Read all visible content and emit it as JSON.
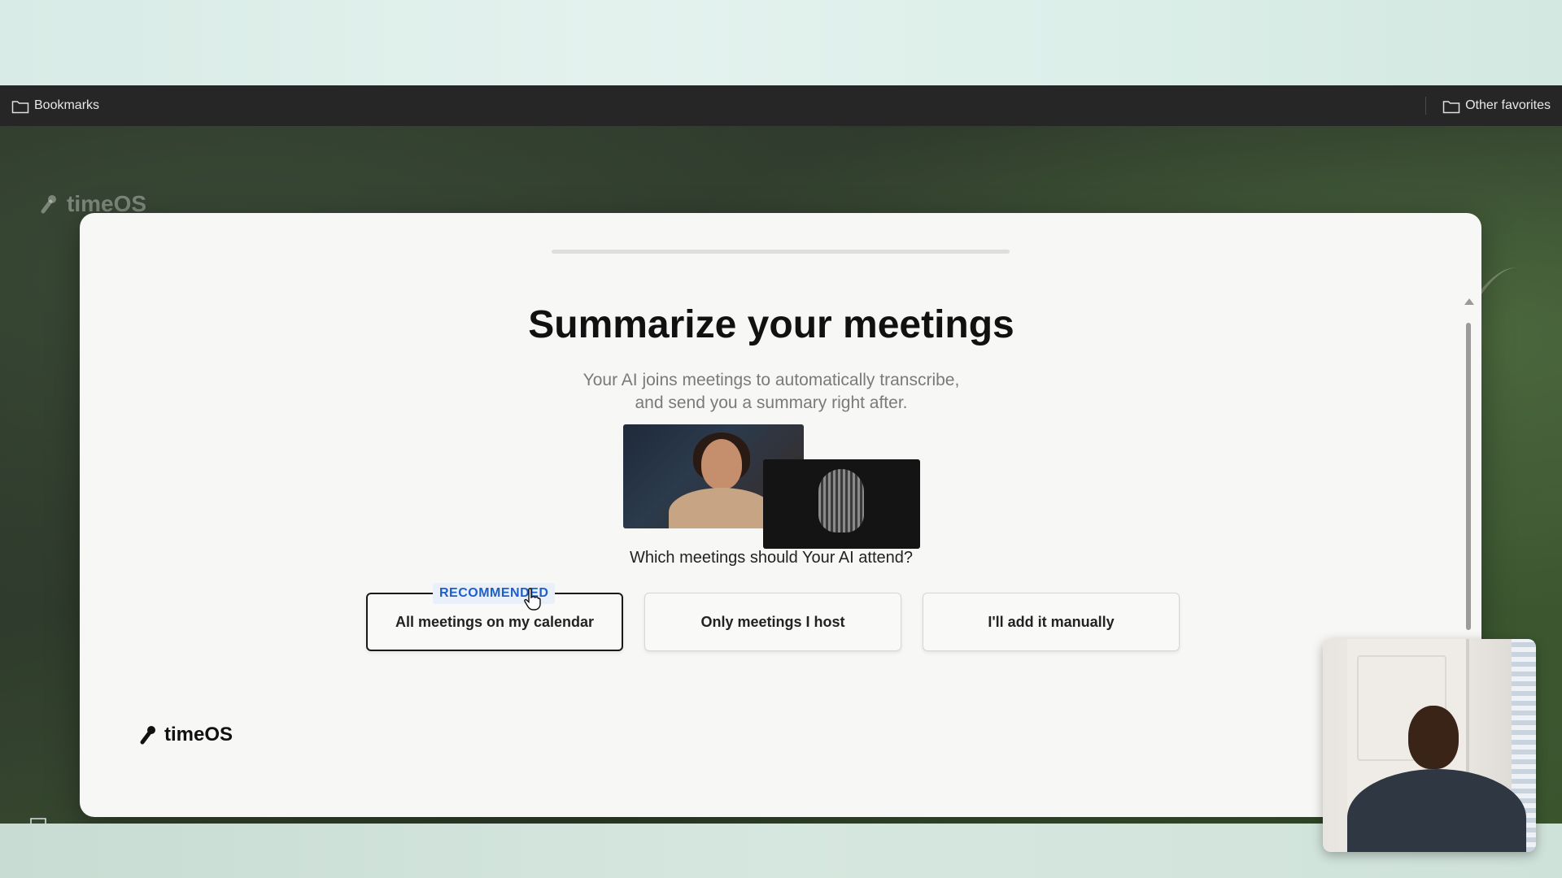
{
  "browser": {
    "bookmarks_label": "Bookmarks",
    "other_favorites_label": "Other favorites"
  },
  "background_logo": "timeOS",
  "modal": {
    "title": "Summarize your meetings",
    "subtitle_line1": "Your AI joins meetings to automatically transcribe,",
    "subtitle_line2": "and send you a summary right after.",
    "question": "Which meetings should Your AI attend?",
    "options": [
      {
        "label": "All meetings on my calendar",
        "badge": "RECOMMENDED",
        "selected": true
      },
      {
        "label": "Only meetings I host",
        "selected": false
      },
      {
        "label": "I'll add it manually",
        "selected": false
      }
    ],
    "brand": "timeOS"
  },
  "colors": {
    "accent_badge_text": "#1f5fc4",
    "accent_badge_bg": "#e9f0fa",
    "modal_bg": "#f7f7f5"
  },
  "icons": [
    "folder-icon",
    "chat-icon",
    "timeos-logo-icon",
    "pointer-cursor-icon"
  ]
}
